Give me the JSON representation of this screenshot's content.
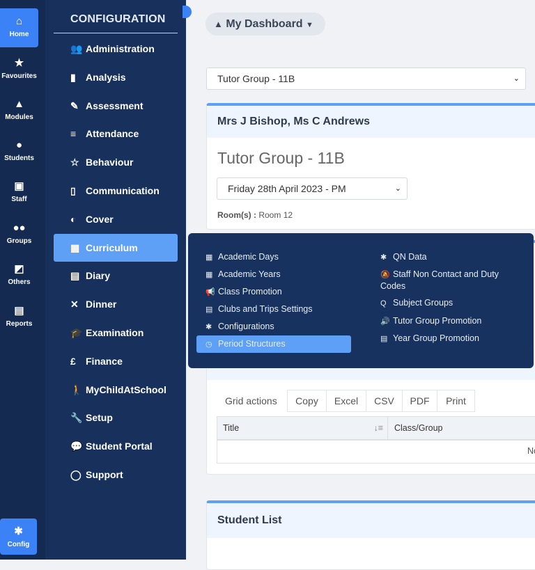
{
  "rail": [
    {
      "label": "Home",
      "icon": "home-icon"
    },
    {
      "label": "Favourites",
      "icon": "star-icon"
    },
    {
      "label": "Modules",
      "icon": "shapes-icon"
    },
    {
      "label": "Students",
      "icon": "user-icon"
    },
    {
      "label": "Staff",
      "icon": "staff-board-icon"
    },
    {
      "label": "Groups",
      "icon": "users-icon"
    },
    {
      "label": "Others",
      "icon": "chart-board-icon"
    },
    {
      "label": "Reports",
      "icon": "file-icon"
    }
  ],
  "rail_config": {
    "label": "Config",
    "icon": "gear-icon"
  },
  "config": {
    "title": "CONFIGURATION",
    "items": [
      {
        "label": "Administration",
        "glyph": "👥"
      },
      {
        "label": "Analysis",
        "glyph": "▮"
      },
      {
        "label": "Assessment",
        "glyph": "✎"
      },
      {
        "label": "Attendance",
        "glyph": "≡"
      },
      {
        "label": "Behaviour",
        "glyph": "☆"
      },
      {
        "label": "Communication",
        "glyph": "▯"
      },
      {
        "label": "Cover",
        "glyph": "◐"
      },
      {
        "label": "Curriculum",
        "glyph": "▦"
      },
      {
        "label": "Diary",
        "glyph": "▤"
      },
      {
        "label": "Dinner",
        "glyph": "✕"
      },
      {
        "label": "Examination",
        "glyph": "🎓"
      },
      {
        "label": "Finance",
        "glyph": "£"
      },
      {
        "label": "MyChildAtSchool",
        "glyph": "🚶"
      },
      {
        "label": "Setup",
        "glyph": "🔧"
      },
      {
        "label": "Student Portal",
        "glyph": "💬"
      },
      {
        "label": "Support",
        "glyph": "◯"
      }
    ]
  },
  "header": {
    "dashboard_label": "My Dashboard"
  },
  "group_select": "Tutor Group - 11B",
  "tutor_card": {
    "header": "Mrs J Bishop, Ms C Andrews",
    "title": "Tutor Group - 11B",
    "date_select": "Friday 28th April 2023 - PM",
    "room_label": "Room(s) :",
    "room_value": "Room 12"
  },
  "curriculum_menu": {
    "left": [
      {
        "label": "Academic Days",
        "glyph": "▦"
      },
      {
        "label": "Academic Years",
        "glyph": "▦"
      },
      {
        "label": "Class Promotion",
        "glyph": "📢"
      },
      {
        "label": "Clubs and Trips Settings",
        "glyph": "▤"
      },
      {
        "label": "Configurations",
        "glyph": "✱"
      },
      {
        "label": "Period Structures",
        "glyph": "◷"
      }
    ],
    "right": [
      {
        "label": "QN Data",
        "glyph": "✱"
      },
      {
        "label": "Staff Non Contact and Duty Codes",
        "glyph": "🔕"
      },
      {
        "label": "Subject Groups",
        "glyph": "Q"
      },
      {
        "label": "Tutor Group Promotion",
        "glyph": "🔊"
      },
      {
        "label": "Year Group Promotion",
        "glyph": "▤"
      }
    ]
  },
  "grid": {
    "actions_label": "Grid actions",
    "buttons": [
      "Copy",
      "Excel",
      "CSV",
      "PDF",
      "Print"
    ],
    "columns": [
      "Title",
      "Class/Group"
    ],
    "empty": "No"
  },
  "student_list": {
    "header": "Student List"
  }
}
